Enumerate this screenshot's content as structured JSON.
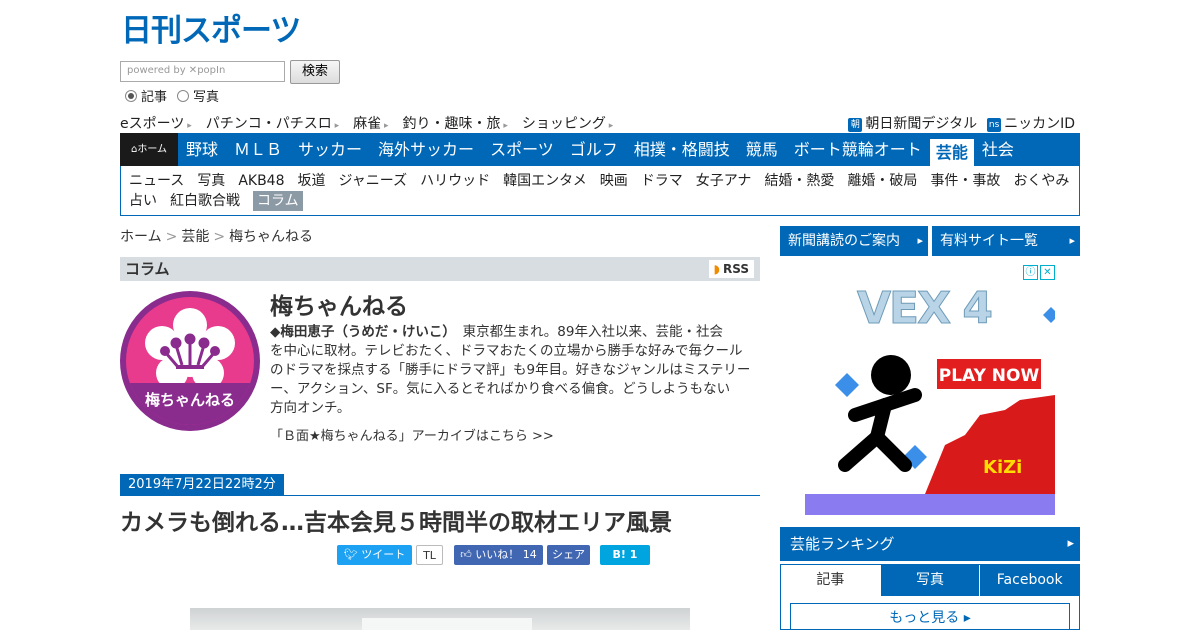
{
  "header": {
    "logo": "日刊スポーツ",
    "search_placeholder": "powered by ✕popIn",
    "search_button": "検索",
    "radio_article": "記事",
    "radio_photo": "写真"
  },
  "toplinks": [
    "eスポーツ",
    "パチンコ・パチスロ",
    "麻雀",
    "釣り・趣味・旅",
    "ショッピング"
  ],
  "toplinks_right": [
    {
      "icon": "朝",
      "label": "朝日新聞デジタル"
    },
    {
      "icon": "ns",
      "label": "ニッカンID"
    }
  ],
  "mainnav": {
    "home": "ホーム",
    "items": [
      "野球",
      "ＭＬＢ",
      "サッカー",
      "海外サッカー",
      "スポーツ",
      "ゴルフ",
      "相撲・格闘技",
      "競馬",
      "ボート競輪オート",
      "芸能",
      "社会"
    ],
    "active": "芸能"
  },
  "subnav": {
    "row1": [
      "ニュース",
      "写真",
      "AKB48",
      "坂道",
      "ジャニーズ",
      "ハリウッド",
      "韓国エンタメ",
      "映画",
      "ドラマ",
      "女子アナ",
      "結婚・熱愛",
      "離婚・破局",
      "事件・事故",
      "おくやみ"
    ],
    "row2": [
      "占い",
      "紅白歌合戦",
      "コラム"
    ],
    "active": "コラム"
  },
  "breadcrumb": [
    "ホーム",
    "芸能",
    "梅ちゃんねる"
  ],
  "column": {
    "bar_title": "コラム",
    "rss": "RSS",
    "badge_label": "梅ちゃんねる",
    "title": "梅ちゃんねる",
    "author": "◆梅田恵子（うめだ・けいこ）",
    "desc_line1": "東京都生まれ。89年入社以来、芸能・社会",
    "desc_line2": "を中心に取材。テレビおたく、ドラマおたくの立場から勝手な好みで毎クール",
    "desc_line3": "のドラマを採点する「勝手にドラマ評」も9年目。好きなジャンルはミステリー",
    "desc_line4": "ー、アクション、SF。気に入るとそればかり食べる偏食。どうしようもない",
    "desc_line5": "方向オンチ。",
    "archive": "「Ｂ面★梅ちゃんねる」アーカイブはこちら >>"
  },
  "article": {
    "date": "2019年7月22日22時2分",
    "headline": "カメラも倒れる…吉本会見５時間半の取材エリア風景",
    "tweet": "ツイート",
    "tl": "TL",
    "like": "いいね！ 14",
    "share": "シェア",
    "hatena": "B! 1"
  },
  "sidebar": {
    "btn1": "新聞講読のご案内",
    "btn2": "有料サイト一覧",
    "ad_title": "VEX 4",
    "ad_cta": "PLAY NOW",
    "ad_brand": "KiZi",
    "ranking": "芸能ランキング",
    "tabs": [
      "記事",
      "写真",
      "Facebook"
    ],
    "more": "もっと見る"
  }
}
